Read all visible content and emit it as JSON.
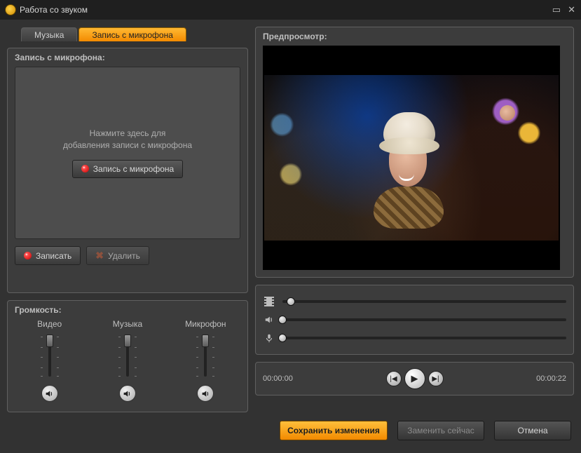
{
  "window": {
    "title": "Работа со звуком"
  },
  "tabs": {
    "music": "Музыка",
    "mic": "Запись с микрофона"
  },
  "record_panel": {
    "header": "Запись с микрофона:",
    "hint_line1": "Нажмите здесь для",
    "hint_line2": "добавления записи с микрофона",
    "record_from_mic": "Запись с микрофона",
    "record": "Записать",
    "delete": "Удалить"
  },
  "volume_panel": {
    "header": "Громкость:",
    "cols": {
      "video": "Видео",
      "music": "Музыка",
      "mic": "Микрофон"
    }
  },
  "preview_panel": {
    "header": "Предпросмотр:"
  },
  "playbar": {
    "current": "00:00:00",
    "total": "00:00:22"
  },
  "footer": {
    "save": "Сохранить изменения",
    "replace_now": "Заменить сейчас",
    "cancel": "Отмена"
  }
}
